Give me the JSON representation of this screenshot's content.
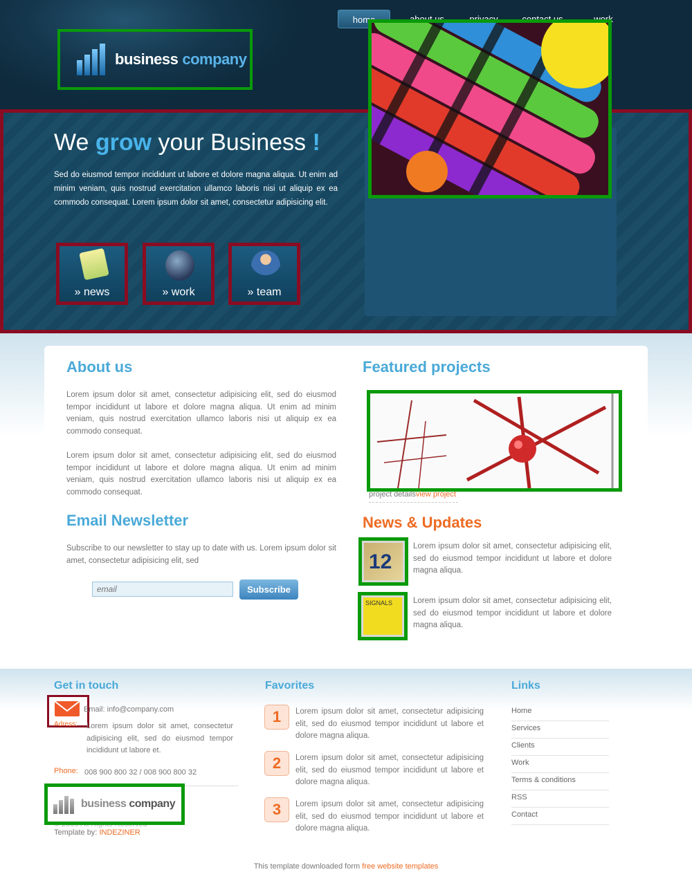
{
  "nav": {
    "items": [
      "home",
      "about us",
      "privacy",
      "contact us",
      "work"
    ],
    "active": "home"
  },
  "logo": {
    "word1": "business",
    "word2": "company"
  },
  "hero": {
    "title_part1": "We ",
    "title_accent": "grow",
    "title_part2": " your Business ",
    "title_excl": "!",
    "text": "Sed do eiusmod tempor incididunt ut labore et dolore magna aliqua. Ut enim ad minim veniam, quis nostrud exercitation ullamco laboris nisi ut aliquip ex ea commodo consequat. Lorem ipsum dolor sit amet, consectetur adipisicing elit.",
    "buttons": [
      {
        "label": "» news",
        "icon": "notepad-icon"
      },
      {
        "label": "» work",
        "icon": "ink-pen-icon"
      },
      {
        "label": "» team",
        "icon": "worker-icon"
      }
    ]
  },
  "about": {
    "title": "About us",
    "para1": "Lorem ipsum dolor sit amet, consectetur adipisicing elit, sed do eiusmod tempor incididunt ut labore et dolore magna aliqua. Ut enim ad minim veniam, quis nostrud exercitation ullamco laboris nisi ut aliquip ex ea commodo consequat.",
    "para2": "Lorem ipsum dolor sit amet, consectetur adipisicing elit, sed do eiusmod tempor incididunt ut labore et dolore magna aliqua. Ut enim ad minim veniam, quis nostrud exercitation ullamco laboris nisi ut aliquip ex ea commodo consequat."
  },
  "newsletter": {
    "title": "Email Newsletter",
    "text": "Subscribe to our newsletter to stay up to date with us. Lorem ipsum dolor sit amet, consectetur adipisicing elit, sed",
    "email_placeholder": "email",
    "button": "Subscribe"
  },
  "featured": {
    "title": "Featured projects",
    "details_label": "project details",
    "view_link": "view project"
  },
  "news": {
    "title": "News & Updates",
    "items": [
      {
        "text": "Lorem ipsum dolor sit amet, consectetur adipisicing elit, sed do eiusmod tempor incididunt ut labore et dolore magna aliqua.",
        "thumb": "12"
      },
      {
        "text": "Lorem ipsum dolor sit amet, consectetur adipisicing elit, sed do eiusmod tempor incididunt ut labore et dolore magna aliqua.",
        "thumb": "SIGNALS"
      }
    ]
  },
  "footer": {
    "contact": {
      "title": "Get in touch",
      "email_label": "Email:",
      "email": "info@company.com",
      "address_label": "Adress:",
      "address": "Lorem ipsum dolor sit amet, consectetur adipisicing elit, sed do eiusmod tempor incididunt ut labore et.",
      "phone_label": "Phone:",
      "phone": "008 900 800 32 / 008 900 800 32"
    },
    "logo": {
      "word1": "business",
      "word2": "company"
    },
    "copyright": "© 2009 All Rights Reserved",
    "template_by_label": "Template by:",
    "template_by": "INDEZINER",
    "favorites": {
      "title": "Favorites",
      "items": [
        {
          "num": "1",
          "text": "Lorem ipsum dolor sit amet, consectetur adipisicing elit, sed do eiusmod tempor incididunt ut labore et dolore magna aliqua."
        },
        {
          "num": "2",
          "text": "Lorem ipsum dolor sit amet, consectetur adipisicing elit, sed do eiusmod tempor incididunt ut labore et dolore magna aliqua."
        },
        {
          "num": "3",
          "text": "Lorem ipsum dolor sit amet, consectetur adipisicing elit, sed do eiusmod tempor incididunt ut labore et dolore magna aliqua."
        }
      ]
    },
    "links": {
      "title": "Links",
      "items": [
        "Home",
        "Services",
        "Clients",
        "Work",
        "Terms & conditions",
        "RSS",
        "Contact"
      ]
    },
    "credit_text": "This template downloaded form ",
    "credit_link": "free website templates"
  },
  "colors": {
    "accent_blue": "#4aa9d8",
    "accent_orange": "#ee6b23",
    "header_bg": "#14364c",
    "highlight_green": "#0a9a0a",
    "highlight_red": "#8a0c22"
  }
}
